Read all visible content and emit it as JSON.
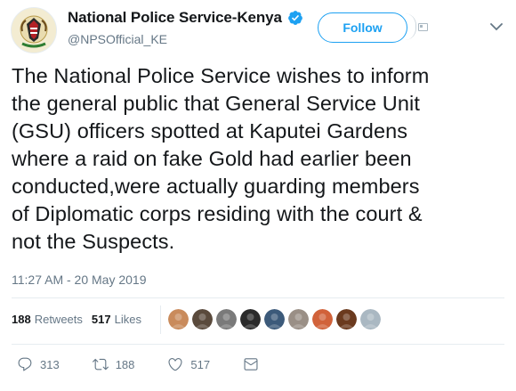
{
  "account": {
    "display_name": "National Police Service-Kenya",
    "handle": "@NPSOfficial_KE",
    "verified": true
  },
  "header": {
    "follow_label": "Follow"
  },
  "tweet": {
    "text": "The National Police Service wishes to inform\nthe general public that General Service Unit\n(GSU) officers spotted at Kaputei Gardens\nwhere a raid on fake Gold had earlier been\nconducted,were actually guarding members\nof Diplomatic corps residing with the court &\nnot the Suspects.",
    "timestamp": "11:27 AM - 20 May 2019"
  },
  "stats": {
    "retweets_count": "188",
    "retweets_label": "Retweets",
    "likes_count": "517",
    "likes_label": "Likes"
  },
  "liker_avatars": [
    {
      "color": "#c98b5c"
    },
    {
      "color": "#5a4a3c"
    },
    {
      "color": "#7a7a7a"
    },
    {
      "color": "#2b2b2b"
    },
    {
      "color": "#3c5a7a"
    },
    {
      "color": "#9a8f86"
    },
    {
      "color": "#d1623a"
    },
    {
      "color": "#6b3a1e"
    },
    {
      "color": "#aab8c2"
    }
  ],
  "actions": {
    "replies": "313",
    "retweets": "188",
    "likes": "517"
  },
  "colors": {
    "accent": "#1da1f2",
    "text": "#14171a",
    "muted": "#657786",
    "border": "#e6ecf0"
  }
}
